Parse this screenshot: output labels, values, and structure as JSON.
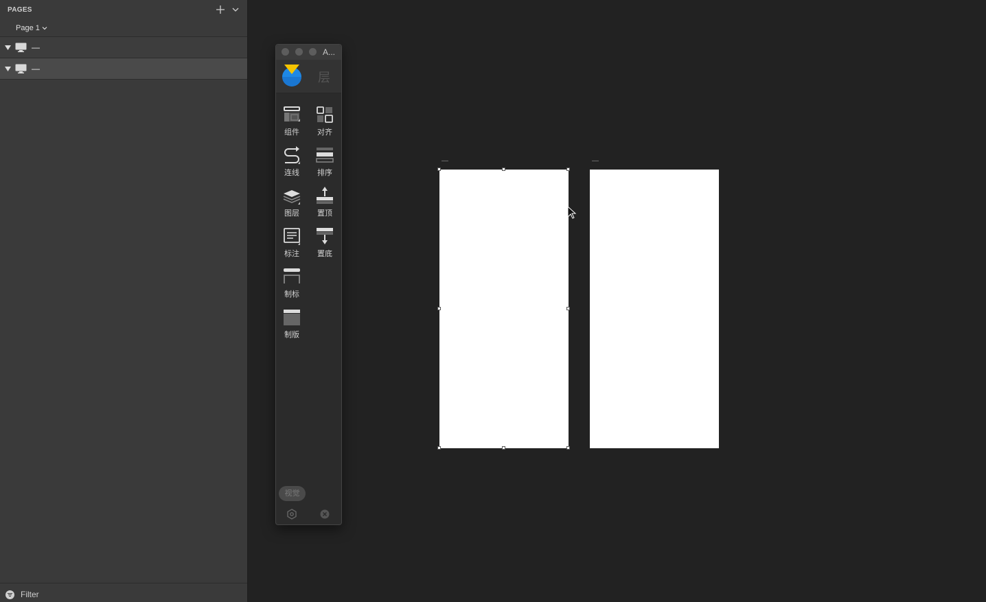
{
  "sidebar": {
    "pages_title": "PAGES",
    "current_page": "Page 1",
    "layers": [
      {
        "name": "—",
        "icon": "monitor-icon"
      },
      {
        "name": "—",
        "icon": "monitor-icon"
      }
    ],
    "filter_label": "Filter"
  },
  "panel": {
    "title": "A...",
    "layer_tab_label": "层",
    "tools_left": [
      "组件",
      "连线",
      "图层",
      "标注",
      "制标",
      "制版"
    ],
    "tools_right": [
      "对齐",
      "排序",
      "置顶",
      "置底"
    ],
    "view_button": "视觉"
  },
  "canvas": {
    "artboards": [
      {
        "name": "—",
        "selected": true
      },
      {
        "name": "—",
        "selected": false
      }
    ]
  },
  "colors": {
    "sidebar_bg": "#3a3a3a",
    "canvas_bg": "#222222",
    "selected_row_bg": "#4a4a4a",
    "logo_yellow": "#f5c400",
    "logo_blue": "#1e88e5"
  }
}
